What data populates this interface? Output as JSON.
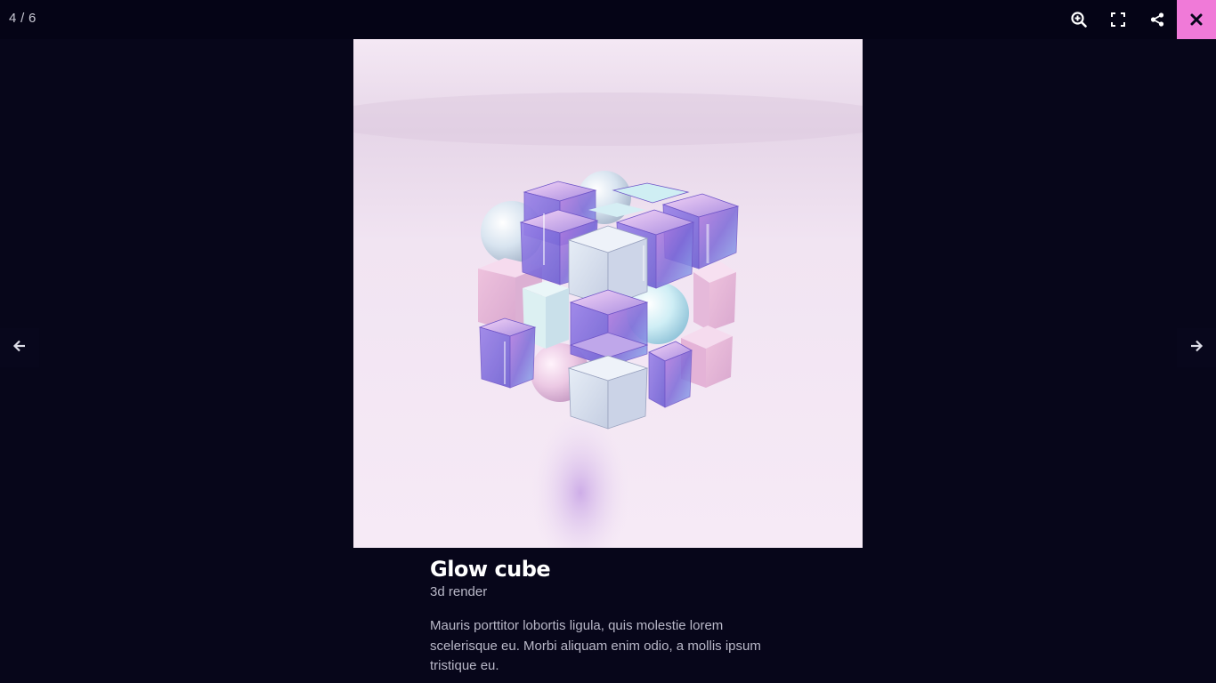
{
  "counter": "4 / 6",
  "toolbar": {
    "zoom_icon": "zoom-in-icon",
    "fullscreen_icon": "fullscreen-icon",
    "share_icon": "share-icon",
    "close_icon": "close-icon",
    "close_bg": "#f07ad8"
  },
  "navigation": {
    "prev_icon": "arrow-left-icon",
    "next_icon": "arrow-right-icon"
  },
  "image": {
    "subject": "3D render of a glass cube made of small iridescent blocks and pearl spheres on a soft lilac background"
  },
  "caption": {
    "title": "Glow cube",
    "subtitle": "3d render",
    "description": "Mauris porttitor lobortis ligula, quis molestie lorem scelerisque eu. Morbi aliquam enim odio, a mollis ipsum tristique eu."
  }
}
